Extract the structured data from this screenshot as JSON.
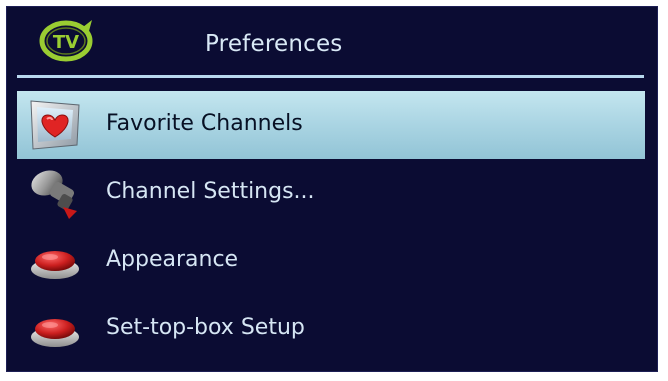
{
  "header": {
    "logo_text": "TV",
    "title": "Preferences"
  },
  "menu": {
    "items": [
      {
        "label": "Favorite Channels",
        "icon": "heart-tv-icon",
        "selected": true
      },
      {
        "label": "Channel Settings...",
        "icon": "satellite-dish-icon",
        "selected": false
      },
      {
        "label": "Appearance",
        "icon": "red-button-icon",
        "selected": false
      },
      {
        "label": "Set-top-box Setup",
        "icon": "red-button-icon",
        "selected": false
      }
    ]
  },
  "colors": {
    "background": "#0b0c33",
    "divider": "#b8d8ee",
    "highlight": "#acd6e4",
    "text": "#d6e6f4",
    "selected_text": "#071024",
    "logo_green": "#9acd32",
    "button_red": "#cc1f1f"
  }
}
